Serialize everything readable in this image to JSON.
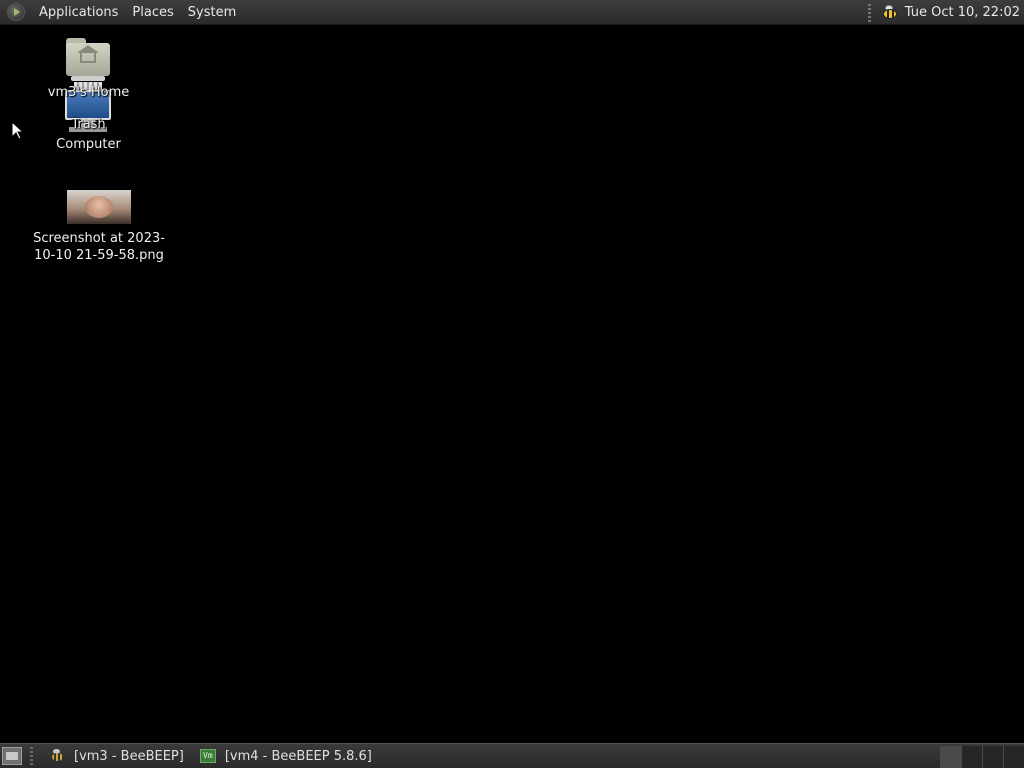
{
  "top_panel": {
    "menus": [
      "Applications",
      "Places",
      "System"
    ],
    "clock": "Tue Oct 10, 22:02"
  },
  "desktop": {
    "icons": [
      {
        "label": "vm3's Home",
        "icon": "home-folder-icon"
      },
      {
        "label": "Trash",
        "icon": "trash-icon"
      },
      {
        "label": "Computer",
        "icon": "computer-icon"
      },
      {
        "label": "Screenshot at 2023-10-10 21-59-58.png",
        "icon": "image-thumbnail-icon"
      }
    ]
  },
  "bottom_panel": {
    "tasks": [
      {
        "label": "[vm3 - BeeBEEP]",
        "icon": "beebeep-icon"
      },
      {
        "label": "[vm4 - BeeBEEP 5.8.6]",
        "icon": "vm-icon",
        "icon_text": "Vm"
      }
    ],
    "workspaces": 4
  }
}
